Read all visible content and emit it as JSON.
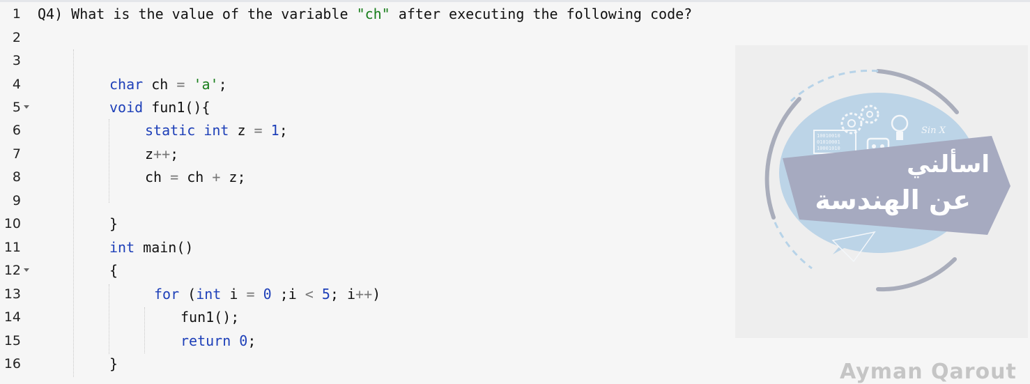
{
  "question": {
    "prefix": "Q4) What is the value of the variable ",
    "quoted": "\"ch\"",
    "suffix": " after executing the following code?"
  },
  "line_numbers": [
    "1",
    "2",
    "3",
    "4",
    "5",
    "6",
    "7",
    "8",
    "9",
    "10",
    "11",
    "12",
    "13",
    "14",
    "15",
    "16"
  ],
  "code": {
    "l4": {
      "kw": "char",
      "a": " ch ",
      "op": "=",
      "b": " ",
      "str": "'a'",
      "c": ";"
    },
    "l5": {
      "kw": "void",
      "a": " fun1(){"
    },
    "l6": {
      "kw1": "static",
      "s1": " ",
      "kw2": "int",
      "a": " z ",
      "op": "=",
      "b": " ",
      "num": "1",
      "c": ";"
    },
    "l7": {
      "a": "z",
      "op": "++",
      "b": ";"
    },
    "l8": {
      "a": "ch ",
      "op1": "=",
      "b": " ch ",
      "op2": "+",
      "c": " z;"
    },
    "l10": {
      "a": "}"
    },
    "l11": {
      "kw": "int",
      "a": " main()"
    },
    "l12": {
      "a": "{"
    },
    "l13": {
      "kw1": "for",
      "a": " (",
      "kw2": "int",
      "b": " i ",
      "op1": "=",
      "c": " ",
      "num1": "0",
      "d": " ;i ",
      "op2": "<",
      "e": " ",
      "num2": "5",
      "f": "; i",
      "op3": "++",
      "g": ")"
    },
    "l14": {
      "a": "fun1();"
    },
    "l15": {
      "kw": "return",
      "a": " ",
      "num": "0",
      "b": ";"
    },
    "l16": {
      "a": "}"
    }
  },
  "watermark": {
    "title_line1": "اسألني",
    "title_line2": "عن الهندسة",
    "bits1": "10010010",
    "bits2": "01010001",
    "bits3": "10001010",
    "sinx": "Sin X",
    "author": "Ayman Qarout"
  },
  "colors": {
    "keyword": "#1d3fb8",
    "string": "#177d1a",
    "operator": "#777777",
    "logo_blue": "#b9d2e6",
    "logo_gray": "#a6aac0"
  }
}
